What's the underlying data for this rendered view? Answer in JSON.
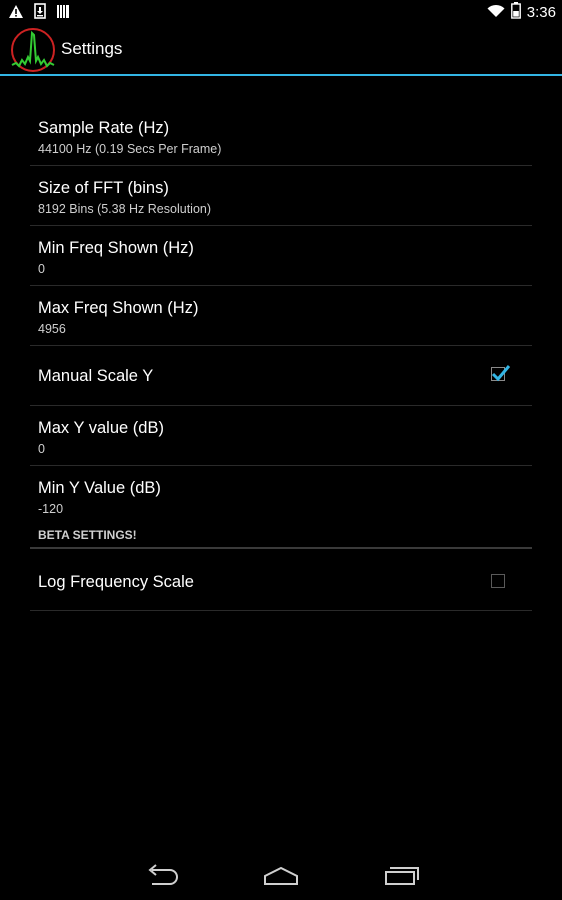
{
  "status_bar": {
    "time": "3:36",
    "icons": [
      "warning-icon",
      "download-icon",
      "barcode-icon",
      "wifi-icon",
      "battery-icon"
    ]
  },
  "action_bar": {
    "title": "Settings",
    "icon": "spectrum-app-icon"
  },
  "preferences": [
    {
      "title": "Sample Rate (Hz)",
      "summary": "44100 Hz (0.19 Secs Per Frame)"
    },
    {
      "title": "Size of FFT (bins)",
      "summary": "8192 Bins (5.38 Hz Resolution)"
    },
    {
      "title": "Min Freq Shown (Hz)",
      "summary": "0"
    },
    {
      "title": "Max Freq Shown (Hz)",
      "summary": "4956"
    },
    {
      "title": "Manual Scale Y",
      "checked": true
    },
    {
      "title": "Max Y value (dB)",
      "summary": "0"
    },
    {
      "title": "Min Y Value (dB)",
      "summary": "-120"
    }
  ],
  "beta_category": {
    "label": "BETA SETTINGS!",
    "items": [
      {
        "title": "Log Frequency Scale",
        "checked": false
      }
    ]
  },
  "nav_bar": {
    "icons": [
      "back-icon",
      "home-icon",
      "recents-icon"
    ]
  },
  "colors": {
    "accent": "#33b5e5",
    "background": "#000000",
    "app_icon_ring": "#cc2222",
    "app_icon_wave": "#33cc33"
  }
}
